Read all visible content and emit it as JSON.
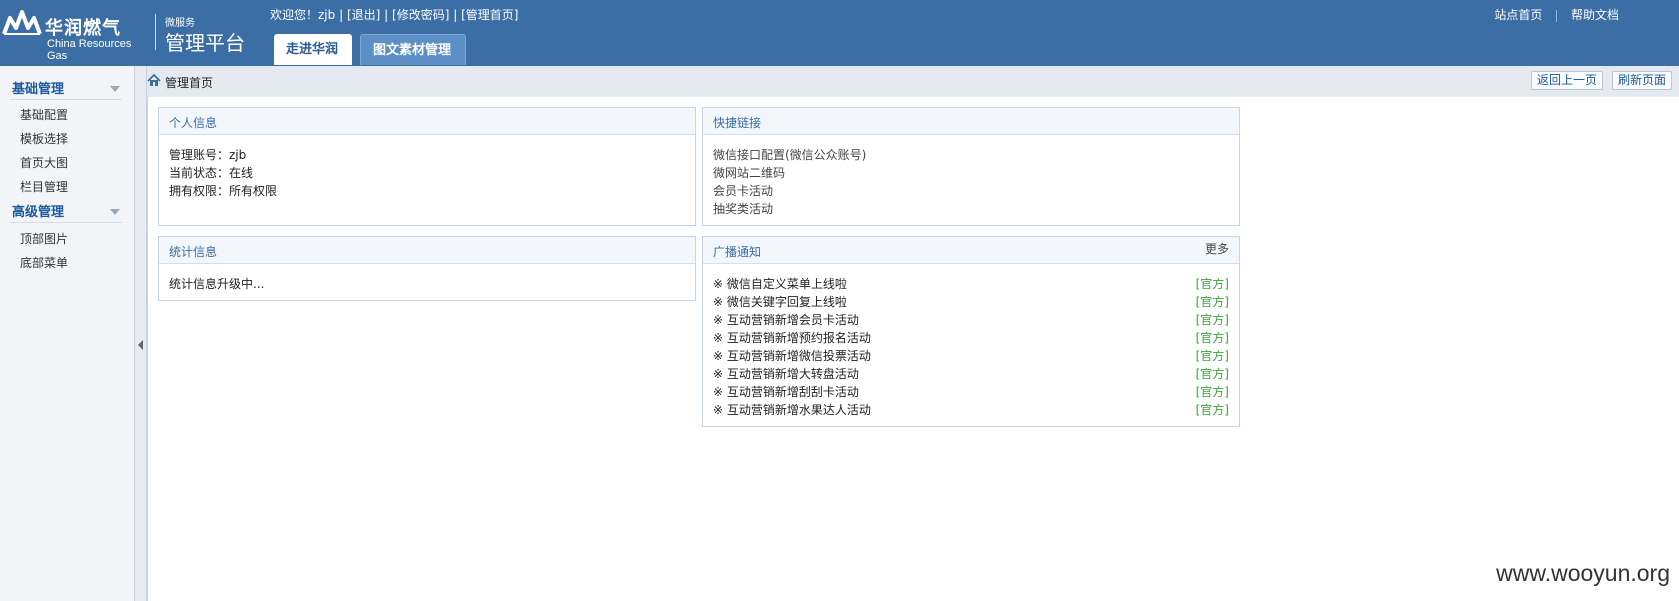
{
  "brand": {
    "name_cn": "华润燃气",
    "name_en": "China Resources Gas",
    "subtitle_small": "微服务",
    "subtitle_big": "管理平台"
  },
  "welcome": {
    "prefix": "欢迎您！zjb",
    "logout": "[退出]",
    "change_password": "[修改密码]",
    "admin_home": "[管理首页]",
    "sep": "|"
  },
  "tabs": [
    "走进华润",
    "图文素材管理"
  ],
  "top_links": [
    "站点首页",
    "帮助文档"
  ],
  "sidebar": {
    "groups": [
      {
        "title": "基础管理",
        "items": [
          "基础配置",
          "模板选择",
          "首页大图",
          "栏目管理"
        ]
      },
      {
        "title": "高级管理",
        "items": [
          "顶部图片",
          "底部菜单"
        ]
      }
    ]
  },
  "breadcrumb": "管理首页",
  "bar_buttons": [
    "返回上一页",
    "刷新页面"
  ],
  "panels": {
    "personal": {
      "title": "个人信息",
      "lines": [
        "管理账号：zjb",
        "当前状态：在线",
        "拥有权限：所有权限"
      ]
    },
    "quicklinks": {
      "title": "快捷链接",
      "links": [
        "微信接口配置(微信公众账号)",
        "微网站二维码",
        "会员卡活动",
        "抽奖类活动"
      ]
    },
    "stats": {
      "title": "统计信息",
      "text": "统计信息升级中..."
    },
    "broadcast": {
      "title": "广播通知",
      "more": "更多",
      "items": [
        {
          "text": "※ 微信自定义菜单上线啦",
          "tag": "[官方]"
        },
        {
          "text": "※ 微信关键字回复上线啦",
          "tag": "[官方]"
        },
        {
          "text": "※ 互动营销新增会员卡活动",
          "tag": "[官方]"
        },
        {
          "text": "※ 互动营销新增预约报名活动",
          "tag": "[官方]"
        },
        {
          "text": "※ 互动营销新增微信投票活动",
          "tag": "[官方]"
        },
        {
          "text": "※ 互动营销新增大转盘活动",
          "tag": "[官方]"
        },
        {
          "text": "※ 互动营销新增刮刮卡活动",
          "tag": "[官方]"
        },
        {
          "text": "※ 互动营销新增水果达人活动",
          "tag": "[官方]"
        }
      ]
    }
  },
  "watermark": "www.wooyun.org",
  "colors": {
    "header_bg": "#3a6ea5",
    "accent": "#1e5aa0",
    "tag_green": "#3aa53a"
  }
}
